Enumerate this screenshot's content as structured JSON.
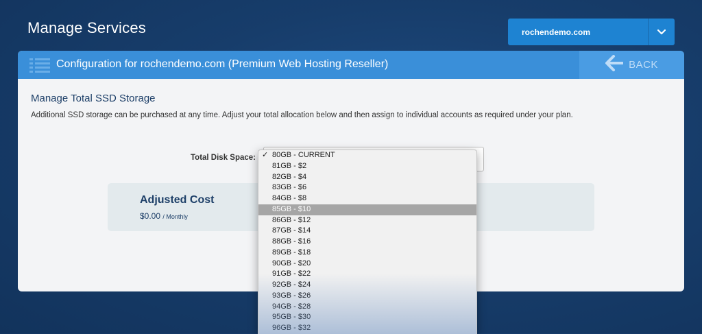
{
  "page": {
    "title": "Manage Services"
  },
  "domain_select": {
    "value": "rochendemo.com"
  },
  "card": {
    "header_title": "Configuration for rochendemo.com (Premium Web Hosting Reseller)",
    "back_label": "BACK",
    "section_title": "Manage Total SSD Storage",
    "description": "Additional SSD storage can be purchased at any time. Adjust your total allocation below and then assign to individual accounts as required under your plan.",
    "disk_label": "Total Disk Space:",
    "cost_title": "Adjusted Cost",
    "cost_value": "$0.00",
    "cost_unit": "/ Monthly"
  },
  "dropdown": {
    "checked_mark": "✓",
    "checked_index": 0,
    "highlighted_index": 5,
    "options": [
      "80GB - CURRENT",
      "81GB - $2",
      "82GB - $4",
      "83GB - $6",
      "84GB - $8",
      "85GB - $10",
      "86GB - $12",
      "87GB - $14",
      "88GB - $16",
      "89GB - $18",
      "90GB - $20",
      "91GB - $22",
      "92GB - $24",
      "93GB - $26",
      "94GB - $28",
      "95GB - $30",
      "96GB - $32"
    ]
  },
  "colors": {
    "background": "#173d6b",
    "accent": "#1e83d2",
    "header": "#3a8fd9",
    "highlight": "#a6a6a6",
    "heading_text": "#1d3f68"
  },
  "icons": {
    "header": "list-icon",
    "domain_select": "chevron-down-icon",
    "back": "arrow-left-icon",
    "option_check": "checkmark-icon"
  }
}
